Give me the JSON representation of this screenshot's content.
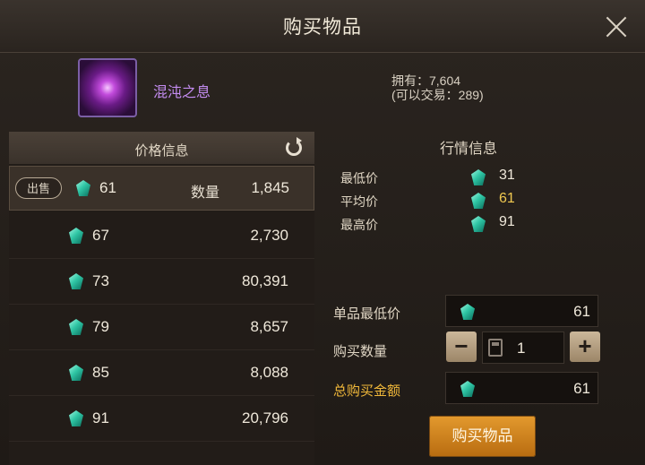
{
  "window": {
    "title": "购买物品"
  },
  "item": {
    "name": "混沌之息",
    "owned": "拥有：7,604",
    "tradable": "(可以交易：289)"
  },
  "price_panel": {
    "title": "价格信息",
    "sell_label": "出售",
    "quantity_label": "数量",
    "rows": [
      {
        "price": "61",
        "qty": "1,845"
      },
      {
        "price": "67",
        "qty": "2,730"
      },
      {
        "price": "73",
        "qty": "80,391"
      },
      {
        "price": "79",
        "qty": "8,657"
      },
      {
        "price": "85",
        "qty": "8,088"
      },
      {
        "price": "91",
        "qty": "20,796"
      }
    ]
  },
  "market": {
    "title": "行情信息",
    "min_label": "最低价",
    "min": "31",
    "avg_label": "平均价",
    "avg": "61",
    "max_label": "最高价",
    "max": "91"
  },
  "form": {
    "unit_min_label": "单品最低价",
    "unit_min": "61",
    "qty_label": "购买数量",
    "qty": "1",
    "total_label": "总购买金额",
    "total": "61",
    "minus": "−",
    "plus": "+"
  },
  "buy_button": "购买物品",
  "colors": {
    "accent": "#d88a22",
    "avg": "#f0c850",
    "item_name": "#c38cf0",
    "gold_label": "#f0b83a"
  }
}
